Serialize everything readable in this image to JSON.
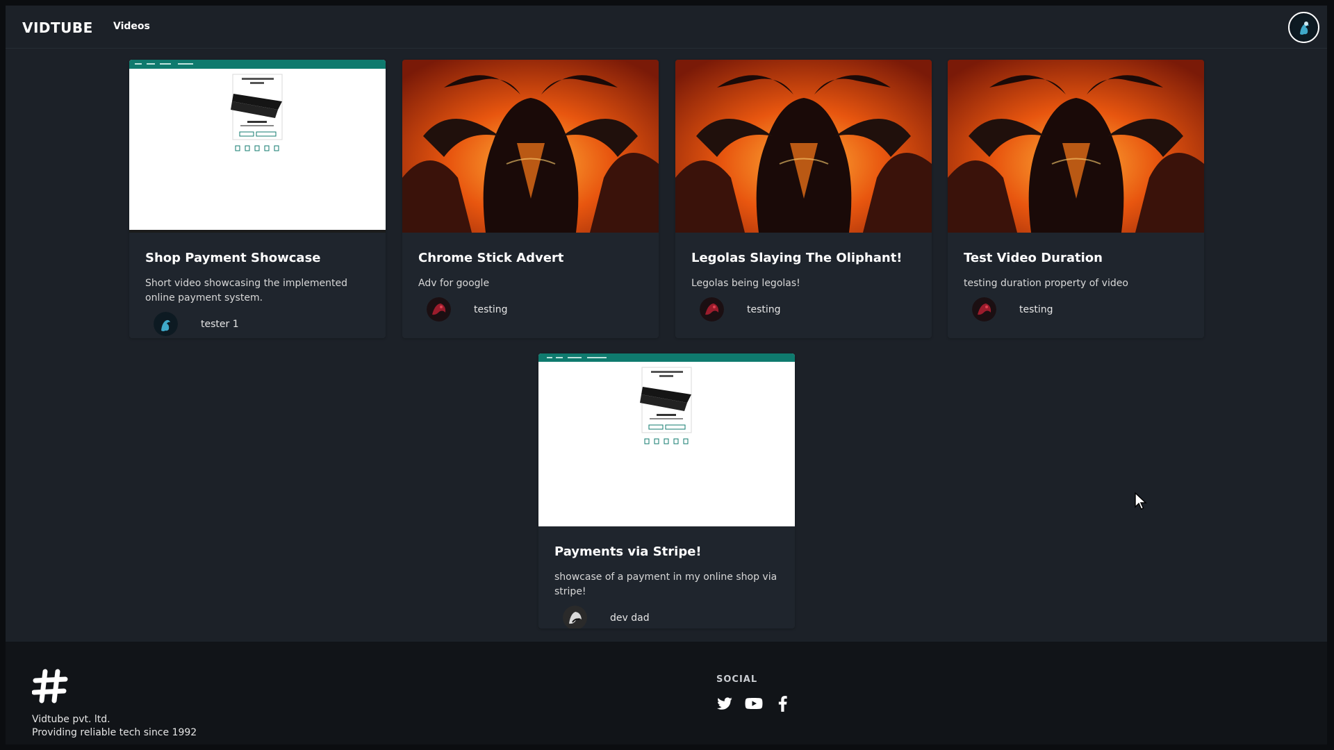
{
  "navbar": {
    "brand": "VIDTUBE",
    "nav_link": "Videos",
    "avatar_icon": "user-avatar-icon"
  },
  "videos": [
    {
      "title": "Shop Payment Showcase",
      "description": "Short video showcasing the implemented online payment system.",
      "author": "tester 1",
      "thumbnail": "shop-screenshot"
    },
    {
      "title": "Chrome Stick Advert",
      "description": "Adv for google",
      "author": "testing",
      "thumbnail": "fire-demon-art"
    },
    {
      "title": "Legolas Slaying The Oliphant!",
      "description": "Legolas being legolas!",
      "author": "testing",
      "thumbnail": "fire-demon-art"
    },
    {
      "title": "Test Video Duration",
      "description": "testing duration property of video",
      "author": "testing",
      "thumbnail": "fire-demon-art"
    },
    {
      "title": "Payments via Stripe!",
      "description": "showcase of a payment in my online shop via stripe!",
      "author": "dev dad",
      "thumbnail": "shop-screenshot"
    }
  ],
  "footer": {
    "company": "Vidtube pvt. ltd.",
    "tagline": "Providing reliable tech since 1992",
    "social_heading": "SOCIAL",
    "social_icons": [
      "twitter-icon",
      "youtube-icon",
      "facebook-icon"
    ]
  },
  "colors": {
    "background": "#1c2128",
    "card": "#1f252d",
    "footer": "#111418",
    "shop_header_teal": "#0f7a6e",
    "fire_orange": "#e8560f"
  }
}
